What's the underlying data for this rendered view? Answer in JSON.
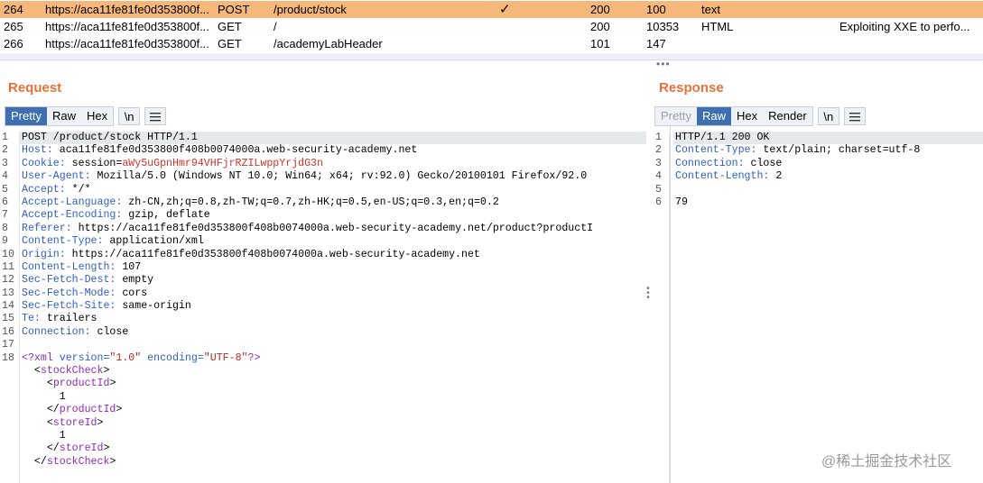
{
  "history": {
    "rows": [
      {
        "num": "264",
        "host": "https://aca11fe81fe0d353800f...",
        "method": "POST",
        "url": "/product/stock",
        "edited": "✓",
        "status": "200",
        "length": "100",
        "mime": "text",
        "title": "",
        "selected": true
      },
      {
        "num": "265",
        "host": "https://aca11fe81fe0d353800f...",
        "method": "GET",
        "url": "/",
        "edited": "",
        "status": "200",
        "length": "10353",
        "mime": "HTML",
        "title": "Exploiting XXE to perfo...",
        "selected": false
      },
      {
        "num": "266",
        "host": "https://aca11fe81fe0d353800f...",
        "method": "GET",
        "url": "/academyLabHeader",
        "edited": "",
        "status": "101",
        "length": "147",
        "mime": "",
        "title": "",
        "selected": false
      }
    ]
  },
  "request": {
    "title": "Request",
    "tabs": {
      "pretty": "Pretty",
      "raw": "Raw",
      "hex": "Hex"
    },
    "newline_btn": "\\n",
    "lines": [
      {
        "n": "1",
        "name": "",
        "value": "POST /product/stock HTTP/1.1"
      },
      {
        "n": "2",
        "name": "Host:",
        "value": " aca11fe81fe0d353800f408b0074000a.web-security-academy.net"
      },
      {
        "n": "3",
        "name": "Cookie:",
        "value": " session=aWy5uGpnHmr94VHFjrRZILwppYrjdG3n"
      },
      {
        "n": "4",
        "name": "User-Agent:",
        "value": " Mozilla/5.0 (Windows NT 10.0; Win64; x64; rv:92.0) Gecko/20100101 Firefox/92.0"
      },
      {
        "n": "5",
        "name": "Accept:",
        "value": " */*"
      },
      {
        "n": "6",
        "name": "Accept-Language:",
        "value": " zh-CN,zh;q=0.8,zh-TW;q=0.7,zh-HK;q=0.5,en-US;q=0.3,en;q=0.2"
      },
      {
        "n": "7",
        "name": "Accept-Encoding:",
        "value": " gzip, deflate"
      },
      {
        "n": "8",
        "name": "Referer:",
        "value": " https://aca11fe81fe0d353800f408b0074000a.web-security-academy.net/product?productI"
      },
      {
        "n": "9",
        "name": "Content-Type:",
        "value": " application/xml"
      },
      {
        "n": "10",
        "name": "Origin:",
        "value": " https://aca11fe81fe0d353800f408b0074000a.web-security-academy.net"
      },
      {
        "n": "11",
        "name": "Content-Length:",
        "value": " 107"
      },
      {
        "n": "12",
        "name": "Sec-Fetch-Dest:",
        "value": " empty"
      },
      {
        "n": "13",
        "name": "Sec-Fetch-Mode:",
        "value": " cors"
      },
      {
        "n": "14",
        "name": "Sec-Fetch-Site:",
        "value": " same-origin"
      },
      {
        "n": "15",
        "name": "Te:",
        "value": " trailers"
      },
      {
        "n": "16",
        "name": "Connection:",
        "value": " close"
      },
      {
        "n": "17",
        "name": "",
        "value": ""
      },
      {
        "n": "18",
        "name": "",
        "value": ""
      }
    ],
    "xml": {
      "decl_open": "<?xml",
      "version_attr": " version=",
      "version_val": "\"1.0\"",
      "encoding_attr": " encoding=",
      "encoding_val": "\"UTF-8\"",
      "decl_close": "?>",
      "body": [
        {
          "indent": "  ",
          "text": "<stockCheck>",
          "kind": "tag"
        },
        {
          "indent": "    ",
          "text": "<productId>",
          "kind": "tag"
        },
        {
          "indent": "      ",
          "text": "1",
          "kind": "text"
        },
        {
          "indent": "    ",
          "text": "</productId>",
          "kind": "tag"
        },
        {
          "indent": "    ",
          "text": "<storeId>",
          "kind": "tag"
        },
        {
          "indent": "      ",
          "text": "1",
          "kind": "text"
        },
        {
          "indent": "    ",
          "text": "</storeId>",
          "kind": "tag"
        },
        {
          "indent": "  ",
          "text": "</stockCheck>",
          "kind": "tag"
        }
      ]
    }
  },
  "response": {
    "title": "Response",
    "tabs": {
      "pretty": "Pretty",
      "raw": "Raw",
      "hex": "Hex",
      "render": "Render"
    },
    "newline_btn": "\\n",
    "lines": [
      {
        "n": "1",
        "name": "",
        "value": "HTTP/1.1 200 OK"
      },
      {
        "n": "2",
        "name": "Content-Type:",
        "value": " text/plain; charset=utf-8"
      },
      {
        "n": "3",
        "name": "Connection:",
        "value": " close"
      },
      {
        "n": "4",
        "name": "Content-Length:",
        "value": " 2"
      },
      {
        "n": "5",
        "name": "",
        "value": ""
      },
      {
        "n": "6",
        "name": "",
        "value": "79"
      }
    ]
  },
  "watermark": "@稀土掘金技术社区"
}
